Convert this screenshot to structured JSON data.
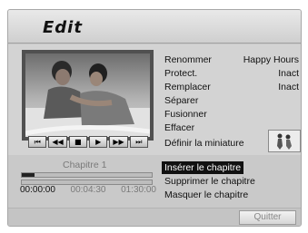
{
  "header": {
    "title": "Edit"
  },
  "player": {
    "controls": [
      {
        "name": "previous-chapter-button",
        "glyph": "⏮"
      },
      {
        "name": "rewind-button",
        "glyph": "◀◀"
      },
      {
        "name": "stop-button",
        "glyph": "■"
      },
      {
        "name": "play-button",
        "glyph": "▶"
      },
      {
        "name": "fast-forward-button",
        "glyph": "▶▶"
      },
      {
        "name": "next-chapter-button",
        "glyph": "⏭"
      }
    ]
  },
  "menu": {
    "items": [
      {
        "label": "Renommer",
        "value": "Happy Hours"
      },
      {
        "label": "Protect.",
        "value": "Inact"
      },
      {
        "label": "Remplacer",
        "value": "Inact"
      },
      {
        "label": "Séparer",
        "value": ""
      },
      {
        "label": "Fusionner",
        "value": ""
      },
      {
        "label": "Effacer",
        "value": ""
      }
    ],
    "thumbnail_label": "Définir la miniature"
  },
  "chapter": {
    "label": "Chapitre 1",
    "progress": 0.1,
    "times": [
      "00:00:00",
      "00:04:30",
      "01:30:00"
    ],
    "actions": [
      {
        "label": "Insérer le chapitre",
        "selected": true
      },
      {
        "label": "Supprimer le chapitre",
        "selected": false
      },
      {
        "label": "Masquer le chapitre",
        "selected": false
      }
    ]
  },
  "footer": {
    "quit_label": "Quitter"
  }
}
